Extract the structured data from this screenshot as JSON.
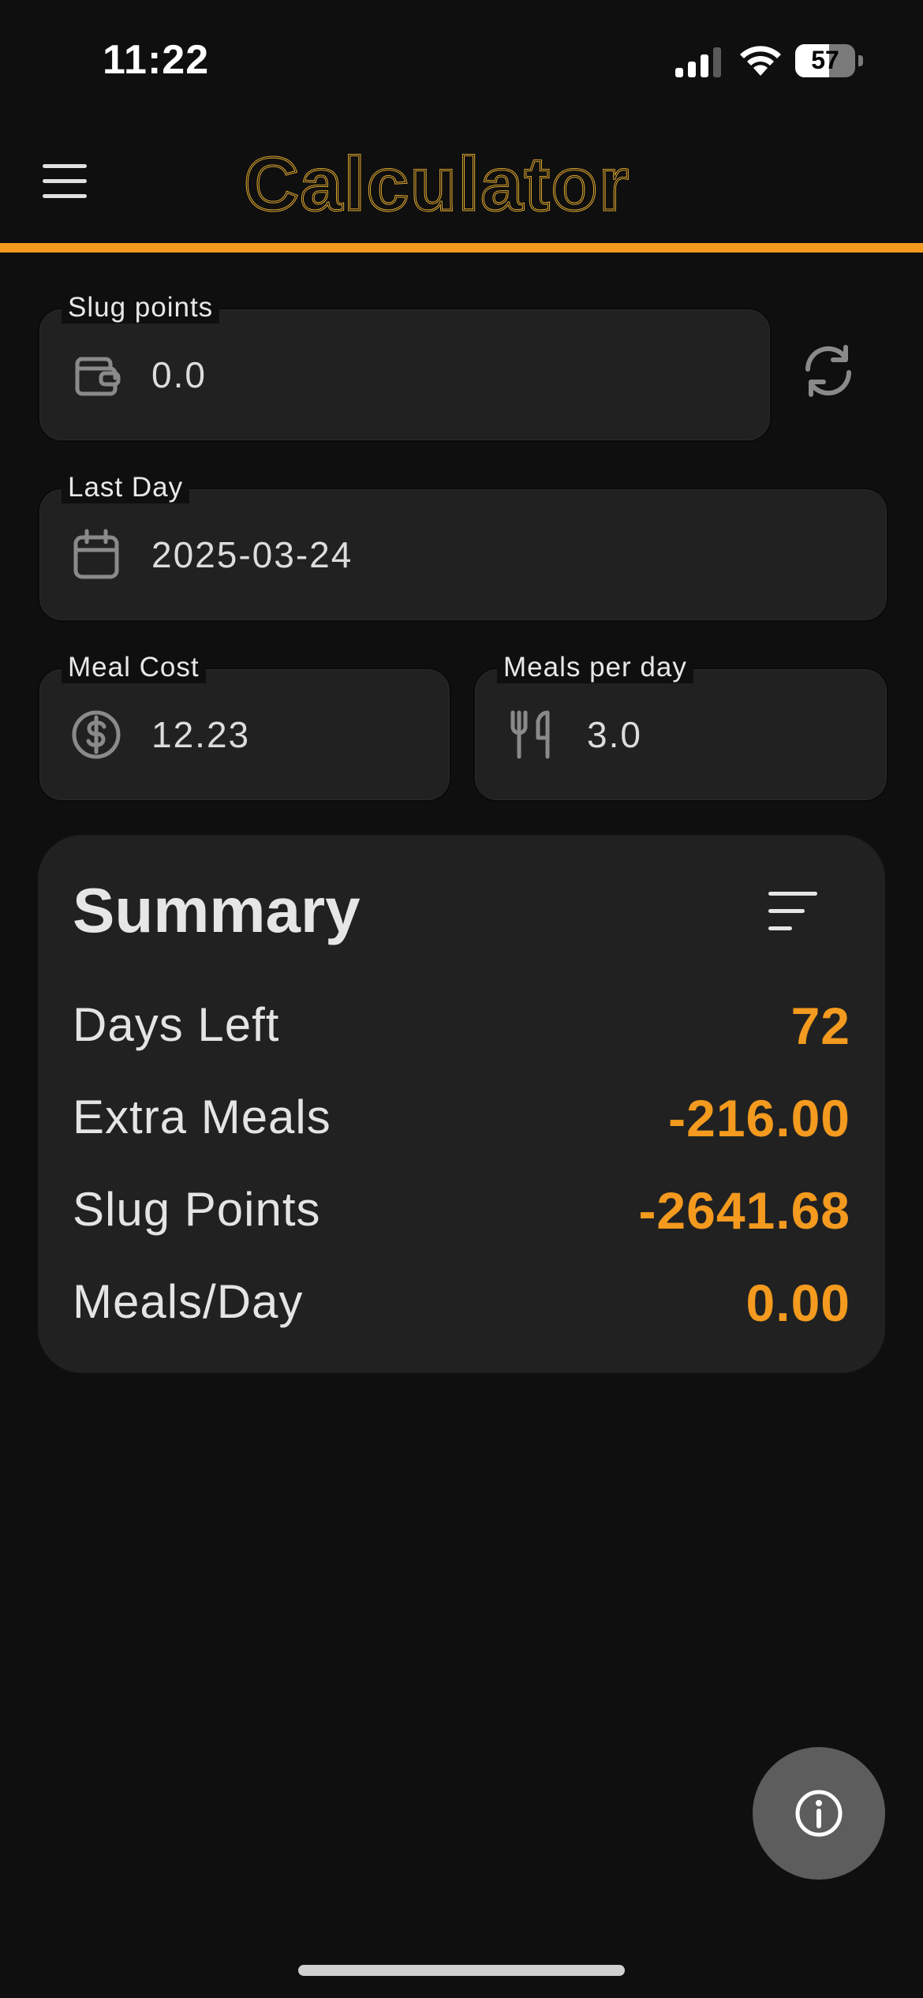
{
  "status_bar": {
    "time": "11:22",
    "battery": "57",
    "battery_level": 0.57
  },
  "app": {
    "title": "Calculator",
    "accent_color": "#f39a1f",
    "title_color": "#f5b731"
  },
  "icons": {
    "menu": "hamburger-menu-icon",
    "wallet": "wallet-icon",
    "refresh": "refresh-icon",
    "calendar": "calendar-icon",
    "dollar": "dollar-circle-icon",
    "utensils": "fork-knife-icon",
    "sort": "sort-lines-icon",
    "info": "info-icon"
  },
  "fields": {
    "slug_points": {
      "label": "Slug points",
      "value": "0.0"
    },
    "last_day": {
      "label": "Last Day",
      "value": "2025-03-24"
    },
    "meal_cost": {
      "label": "Meal Cost",
      "value": "12.23"
    },
    "meals_per_day": {
      "label": "Meals per day",
      "value": "3.0"
    }
  },
  "summary": {
    "title": "Summary",
    "rows": [
      {
        "label": "Days Left",
        "value": "72"
      },
      {
        "label": "Extra Meals",
        "value": "-216.00"
      },
      {
        "label": "Slug Points",
        "value": "-2641.68"
      },
      {
        "label": "Meals/Day",
        "value": "0.00"
      }
    ]
  }
}
